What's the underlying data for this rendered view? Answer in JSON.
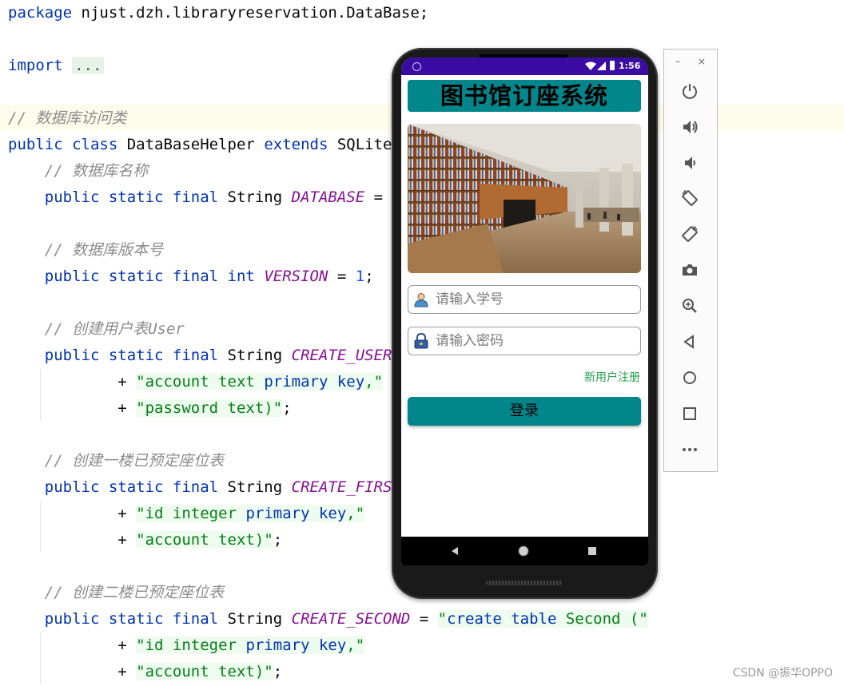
{
  "editor": {
    "lines": [
      {
        "t": [
          {
            "c": "kw",
            "v": "package"
          },
          {
            "c": "",
            "v": " njust.dzh.libraryreservation.DataBase;"
          }
        ]
      },
      {
        "t": [
          {
            "c": "kw",
            "v": "import"
          },
          {
            "c": "",
            "v": " "
          },
          {
            "c": "fold",
            "v": "..."
          }
        ]
      },
      {
        "t": [
          {
            "c": "cm",
            "v": "// 数据库访问类"
          }
        ]
      },
      {
        "t": [
          {
            "c": "kw",
            "v": "public class"
          },
          {
            "c": "",
            "v": " DataBaseHelper "
          },
          {
            "c": "kw",
            "v": "extends"
          },
          {
            "c": "",
            "v": " SQLiteO"
          }
        ]
      },
      {
        "t": [
          {
            "c": "cm",
            "v": "    // 数据库名称"
          }
        ]
      },
      {
        "t": [
          {
            "c": "",
            "v": "    "
          },
          {
            "c": "kw",
            "v": "public static final"
          },
          {
            "c": "",
            "v": " String "
          },
          {
            "c": "const",
            "v": "DATABASE"
          },
          {
            "c": "",
            "v": " = \""
          }
        ]
      },
      {
        "t": [
          {
            "c": "cm",
            "v": "    // 数据库版本号"
          }
        ]
      },
      {
        "t": [
          {
            "c": "",
            "v": "    "
          },
          {
            "c": "kw",
            "v": "public static final int"
          },
          {
            "c": "",
            "v": " "
          },
          {
            "c": "const",
            "v": "VERSION"
          },
          {
            "c": "",
            "v": " = "
          },
          {
            "c": "num",
            "v": "1"
          },
          {
            "c": "",
            "v": ";"
          }
        ]
      },
      {
        "t": [
          {
            "c": "cm",
            "v": "    // 创建用户表User"
          }
        ]
      },
      {
        "t": [
          {
            "c": "",
            "v": "    "
          },
          {
            "c": "kw",
            "v": "public static final"
          },
          {
            "c": "",
            "v": " String "
          },
          {
            "c": "const",
            "v": "CREATE_USER"
          }
        ]
      },
      {
        "t": [
          {
            "c": "",
            "v": "            + "
          },
          {
            "c": "str",
            "v": "\"account text "
          },
          {
            "c": "strkw",
            "v": "primary key"
          },
          {
            "c": "str",
            "v": ",\""
          }
        ]
      },
      {
        "t": [
          {
            "c": "",
            "v": "            + "
          },
          {
            "c": "str",
            "v": "\"password text)\""
          },
          {
            "c": "",
            "v": ";"
          }
        ]
      },
      {
        "t": [
          {
            "c": "cm",
            "v": "    // 创建一楼已预定座位表"
          }
        ]
      },
      {
        "t": [
          {
            "c": "",
            "v": "    "
          },
          {
            "c": "kw",
            "v": "public static final"
          },
          {
            "c": "",
            "v": " String "
          },
          {
            "c": "const",
            "v": "CREATE_FIRST"
          }
        ]
      },
      {
        "t": [
          {
            "c": "",
            "v": "            + "
          },
          {
            "c": "str",
            "v": "\"id integer "
          },
          {
            "c": "strkw",
            "v": "primary key"
          },
          {
            "c": "str",
            "v": ",\""
          }
        ]
      },
      {
        "t": [
          {
            "c": "",
            "v": "            + "
          },
          {
            "c": "str",
            "v": "\"account text)\""
          },
          {
            "c": "",
            "v": ";"
          }
        ]
      },
      {
        "t": [
          {
            "c": "cm",
            "v": "    // 创建二楼已预定座位表"
          }
        ]
      },
      {
        "t": [
          {
            "c": "",
            "v": "    "
          },
          {
            "c": "kw",
            "v": "public static final"
          },
          {
            "c": "",
            "v": " String "
          },
          {
            "c": "const",
            "v": "CREATE_SECOND"
          },
          {
            "c": "",
            "v": " = "
          },
          {
            "c": "str",
            "v": "\""
          },
          {
            "c": "strkw",
            "v": "create table"
          },
          {
            "c": "str",
            "v": " Second (\""
          }
        ]
      },
      {
        "t": [
          {
            "c": "",
            "v": "            + "
          },
          {
            "c": "str",
            "v": "\"id integer "
          },
          {
            "c": "strkw",
            "v": "primary key"
          },
          {
            "c": "str",
            "v": ",\""
          }
        ]
      },
      {
        "t": [
          {
            "c": "",
            "v": "            + "
          },
          {
            "c": "str",
            "v": "\"account text)\""
          },
          {
            "c": "",
            "v": ";"
          }
        ]
      }
    ]
  },
  "phone": {
    "status": {
      "time": "1:56"
    },
    "app_title": "图书馆订座系统",
    "student_id_placeholder": "请输入学号",
    "password_placeholder": "请输入密码",
    "register_link": "新用户注册",
    "login_button": "登录",
    "accent_color": "#00868b"
  },
  "emulator": {
    "window_minimize": "–",
    "window_close": "×",
    "tools": [
      "power-icon",
      "volume-up-icon",
      "volume-down-icon",
      "rotate-left-icon",
      "rotate-right-icon",
      "camera-icon",
      "zoom-icon",
      "back-icon",
      "home-icon",
      "overview-icon",
      "more-icon"
    ]
  },
  "watermark": "CSDN @振华OPPO"
}
